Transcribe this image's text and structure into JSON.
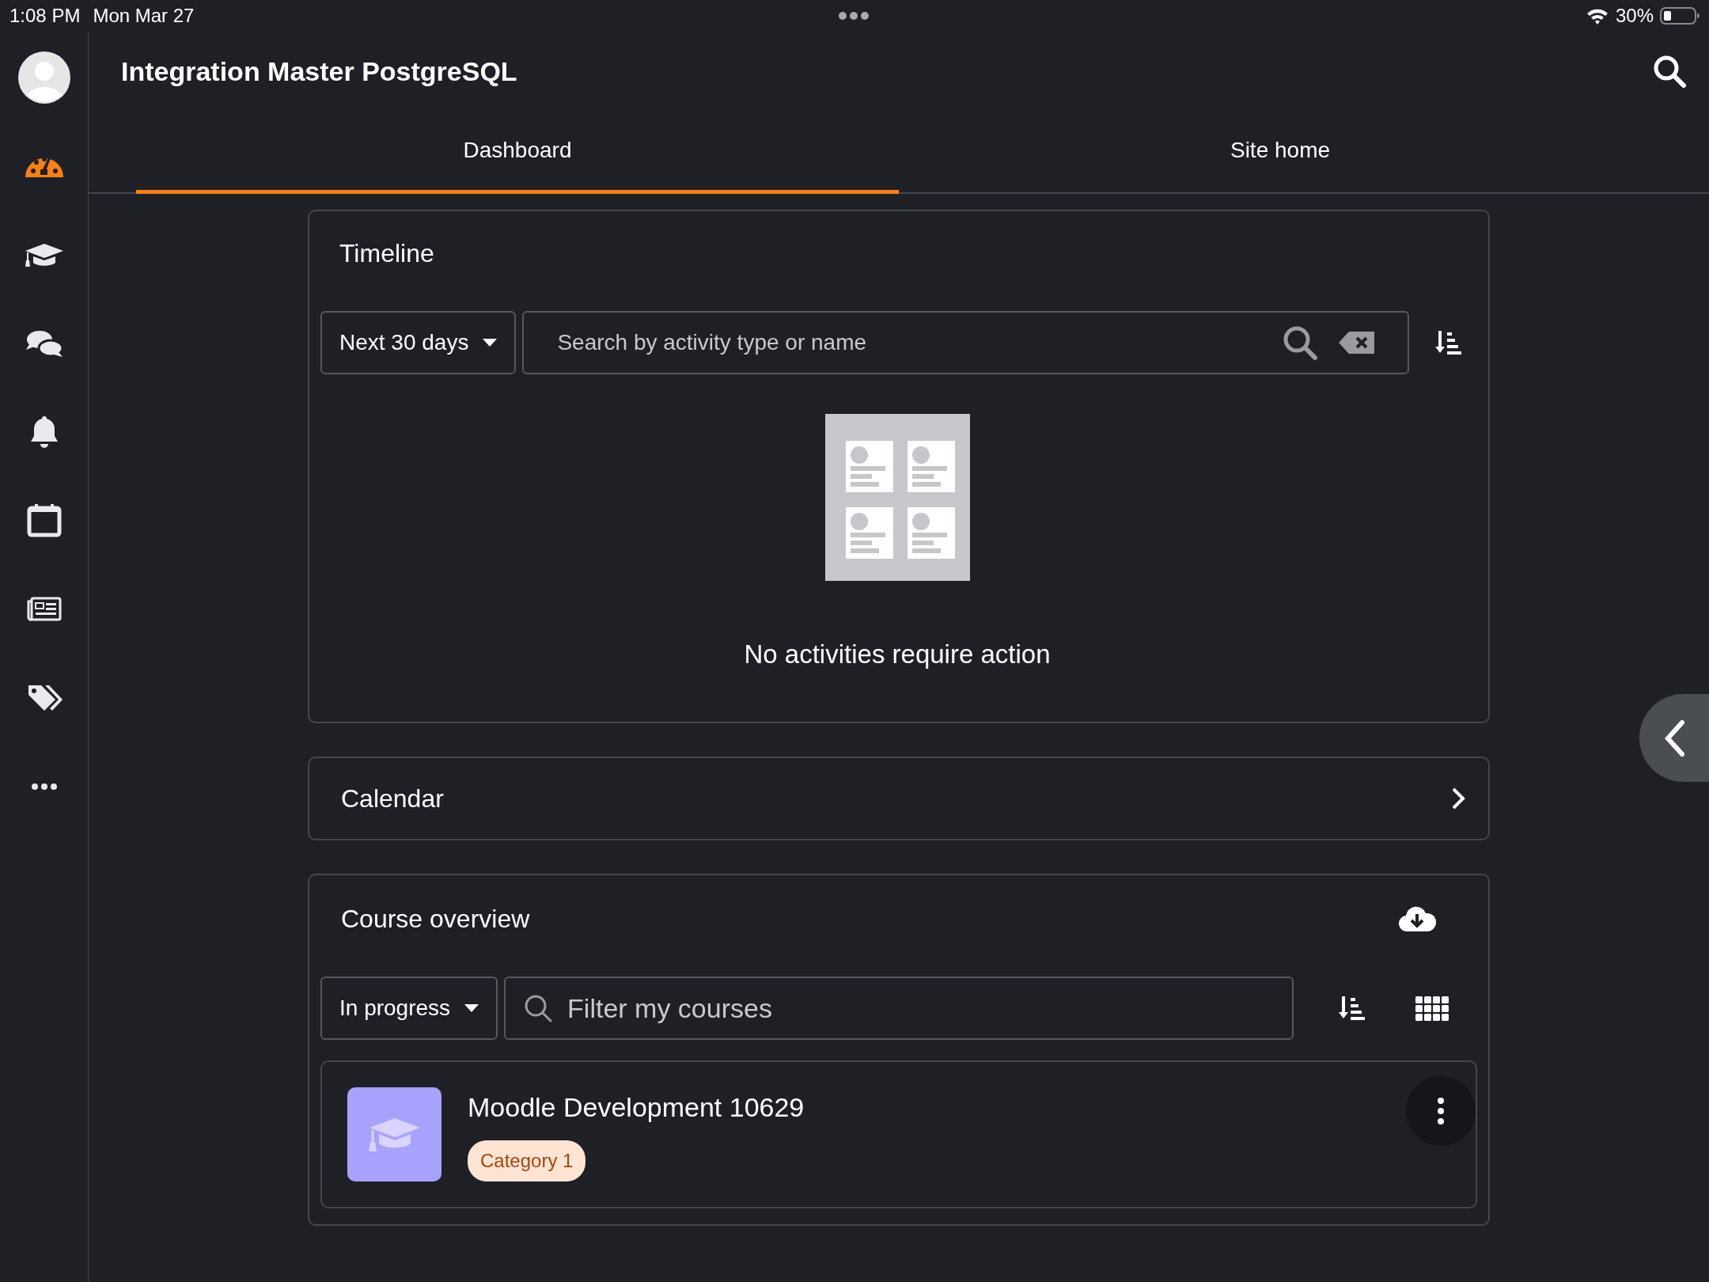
{
  "status_bar": {
    "time": "1:08 PM",
    "date": "Mon Mar 27",
    "battery": "30%"
  },
  "sidebar": {
    "items": [
      {
        "kind": "dashboard",
        "selected": true
      },
      {
        "kind": "courses",
        "selected": false
      },
      {
        "kind": "messages",
        "selected": false
      },
      {
        "kind": "notifications",
        "selected": false
      },
      {
        "kind": "calendar",
        "selected": false
      },
      {
        "kind": "news",
        "selected": false
      },
      {
        "kind": "tags",
        "selected": false
      },
      {
        "kind": "more",
        "selected": false
      }
    ]
  },
  "header": {
    "title": "Integration Master PostgreSQL"
  },
  "tabs": [
    {
      "label": "Dashboard",
      "selected": true
    },
    {
      "label": "Site home",
      "selected": false
    }
  ],
  "timeline": {
    "title": "Timeline",
    "filter": "Next 30 days",
    "search": {
      "placeholder": "Search by activity type or name"
    },
    "empty_message": "No activities require action"
  },
  "calendar": {
    "title": "Calendar"
  },
  "course_overview": {
    "title": "Course overview",
    "filter": "In progress",
    "search": {
      "placeholder": "Filter my courses"
    },
    "courses": [
      {
        "name": "Moodle Development 10629",
        "category": "Category 1"
      }
    ]
  }
}
